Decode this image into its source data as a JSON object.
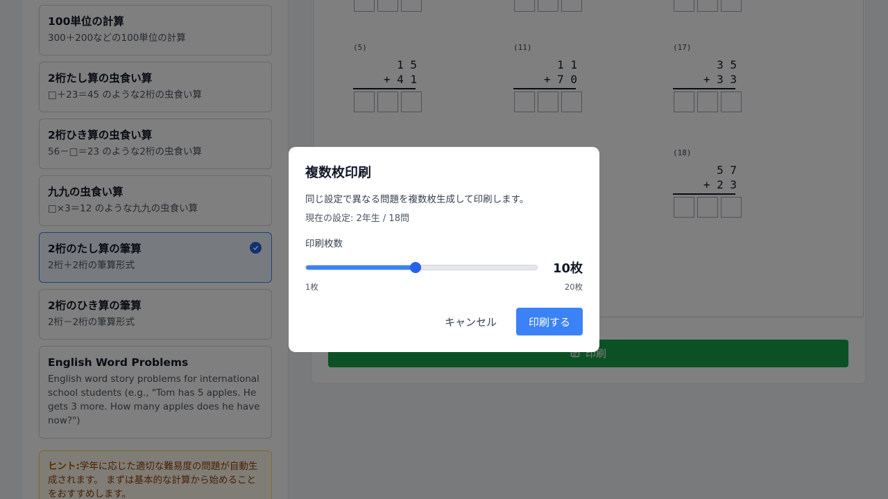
{
  "sidebar": {
    "cards": [
      {
        "title": "100単位の計算",
        "desc": "300＋200などの100単位の計算"
      },
      {
        "title": "2桁たし算の虫食い算",
        "desc": "□＋23＝45 のような2桁の虫食い算"
      },
      {
        "title": "2桁ひき算の虫食い算",
        "desc": "56－□＝23 のような2桁の虫食い算"
      },
      {
        "title": "九九の虫食い算",
        "desc": "□×3＝12 のような九九の虫食い算"
      },
      {
        "title": "2桁のたし算の筆算",
        "desc": "2桁＋2桁の筆算形式"
      },
      {
        "title": "2桁のひき算の筆算",
        "desc": "2桁－2桁の筆算形式"
      },
      {
        "title": "English Word Problems",
        "desc": "English word story problems for international school students (e.g., \"Tom has 5 apples. He gets 3 more. How many apples does he have now?\")"
      }
    ],
    "hint_label": "ヒント:",
    "hint_text": "学年に応じた適切な難易度の問題が自動生成されます。 まずは基本的な計算から始めることをおすすめします。"
  },
  "worksheet": {
    "problems": [
      {
        "num": "(5)",
        "a": "1 5",
        "b": "+ 4 1"
      },
      {
        "num": "(11)",
        "a": "1 1",
        "b": "+ 7 0"
      },
      {
        "num": "(17)",
        "a": "3 5",
        "b": "+ 3 3"
      },
      {
        "num": "(18)",
        "a": "5 7",
        "b": "+ 2 3"
      }
    ],
    "print_button": "印刷"
  },
  "modal": {
    "title": "複数枚印刷",
    "description": "同じ設定で異なる問題を複数枚生成して印刷します。",
    "current_settings": "現在の設定: 2年生 / 18問",
    "count_label": "印刷枚数",
    "count_value": 10,
    "count_display": "10枚",
    "min": 1,
    "max": 20,
    "min_label": "1枚",
    "max_label": "20枚",
    "cancel": "キャンセル",
    "confirm": "印刷する"
  },
  "colors": {
    "accent": "#3b82f6",
    "print_green": "#16a34a"
  }
}
